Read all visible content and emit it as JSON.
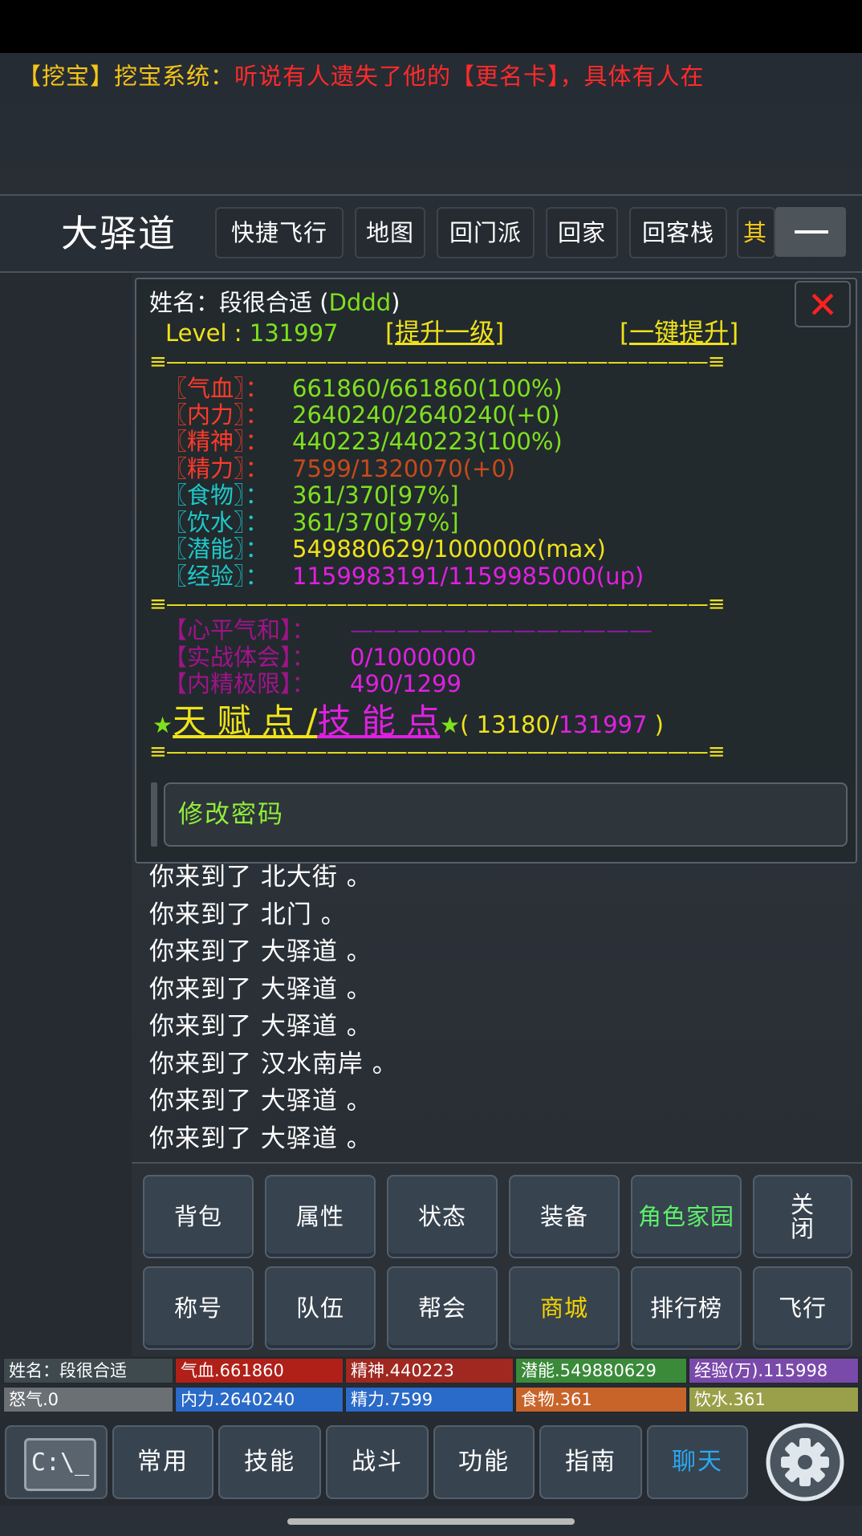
{
  "ticker": {
    "prefix": "【挖宝】挖宝系统：",
    "message": "听说有人遗失了他的【更名卡】，具体有人在"
  },
  "location": {
    "title": "大驿道",
    "nav_buttons": [
      "快捷飞行",
      "地图",
      "回门派",
      "回家",
      "回客栈",
      "其"
    ]
  },
  "panel": {
    "name_label": "姓名：",
    "name_value": "段很合适",
    "name_open": " (",
    "name_id": "Dddd",
    "name_close": ")",
    "level_label": "Level : ",
    "level_value": "131997",
    "upgrade_one": "[提升一级]",
    "upgrade_all": "[一键提升]",
    "close_icon": "close-x-icon",
    "separator": "≡———————————————————————————≡",
    "stats": [
      {
        "label": "〖气血〗：",
        "value": "661860/661860(100%)",
        "label_color": "#ff3a2a",
        "value_color": "#7fe01e"
      },
      {
        "label": "〖内力〗：",
        "value": "2640240/2640240(+0)",
        "label_color": "#ff3a2a",
        "value_color": "#7fe01e"
      },
      {
        "label": "〖精神〗：",
        "value": "440223/440223(100%)",
        "label_color": "#ff3a2a",
        "value_color": "#7fe01e"
      },
      {
        "label": "〖精力〗：",
        "value": "7599/1320070(+0)",
        "label_color": "#ff3a2a",
        "value_color": "#c84a1a"
      },
      {
        "label": "〖食物〗：",
        "value": "361/370[97%]",
        "label_color": "#1ec8c8",
        "value_color": "#7fe01e"
      },
      {
        "label": "〖饮水〗：",
        "value": "361/370[97%]",
        "label_color": "#1ec8c8",
        "value_color": "#7fe01e"
      },
      {
        "label": "〖潜能〗：",
        "value": "549880629/1000000(max)",
        "label_color": "#1ec8c8",
        "value_color": "#f0e21a"
      },
      {
        "label": "〖经验〗：",
        "value": "1159983191/1159985000(up)",
        "label_color": "#1ec8c8",
        "value_color": "#e020e0"
      }
    ],
    "extra": [
      {
        "label": "【心平气和】：",
        "value": "—————————————",
        "label_color": "#a0148a",
        "value_color": "#8a1a9a"
      },
      {
        "label": "【实战体会】：",
        "value": "0/1000000",
        "label_color": "#a0148a",
        "value_color": "#e020e0"
      },
      {
        "label": "【内精极限】：",
        "value": "490/1299",
        "label_color": "#a0148a",
        "value_color": "#e020e0"
      }
    ],
    "talent_star": "★",
    "talent_label": "天 赋 点 /",
    "skill_label": "技 能 点",
    "points_open": "( ",
    "points_current": "13180",
    "points_slash": "/",
    "points_max": "131997",
    "points_close": " )",
    "change_password": "修改密码"
  },
  "log": [
    "你来到了 北大街 。",
    "你来到了 北门 。",
    "你来到了 大驿道 。",
    "你来到了 大驿道 。",
    "你来到了 大驿道 。",
    "你来到了 汉水南岸 。",
    "你来到了 大驿道 。",
    "你来到了 大驿道 。"
  ],
  "action_grid": {
    "row1": [
      "背包",
      "属性",
      "状态",
      "装备",
      "角色家园"
    ],
    "close_label_line1": "关",
    "close_label_line2": "闭",
    "row2": [
      "称号",
      "队伍",
      "帮会",
      "商城",
      "排行榜",
      "飞行"
    ]
  },
  "status_strip": {
    "row1": [
      {
        "text": "姓名：段很合适",
        "bg": "#3e4a4e",
        "fg": "#ffffff"
      },
      {
        "text": "气血.661860",
        "bg": "#b02018",
        "fg": "#ffffff"
      },
      {
        "text": "精神.440223",
        "bg": "#a02820",
        "fg": "#ffffff"
      },
      {
        "text": "潜能.549880629",
        "bg": "#3a8a3a",
        "fg": "#ffffff"
      },
      {
        "text": "经验(万).115998",
        "bg": "#7a4aaa",
        "fg": "#ffffff"
      }
    ],
    "row2": [
      {
        "text": "怒气.0",
        "bg": "#6a7074",
        "fg": "#ffffff"
      },
      {
        "text": "内力.2640240",
        "bg": "#2a6ac8",
        "fg": "#ffffff"
      },
      {
        "text": "精力.7599",
        "bg": "#2a6ac8",
        "fg": "#ffffff"
      },
      {
        "text": "食物.361",
        "bg": "#c8642a",
        "fg": "#ffffff"
      },
      {
        "text": "饮水.361",
        "bg": "#9aa04a",
        "fg": "#ffffff"
      }
    ]
  },
  "bottom_tabs": {
    "console_icon_text": "C:\\_",
    "tabs": [
      "常用",
      "技能",
      "战斗",
      "功能",
      "指南",
      "聊天"
    ],
    "settings_icon": "gear-icon"
  }
}
